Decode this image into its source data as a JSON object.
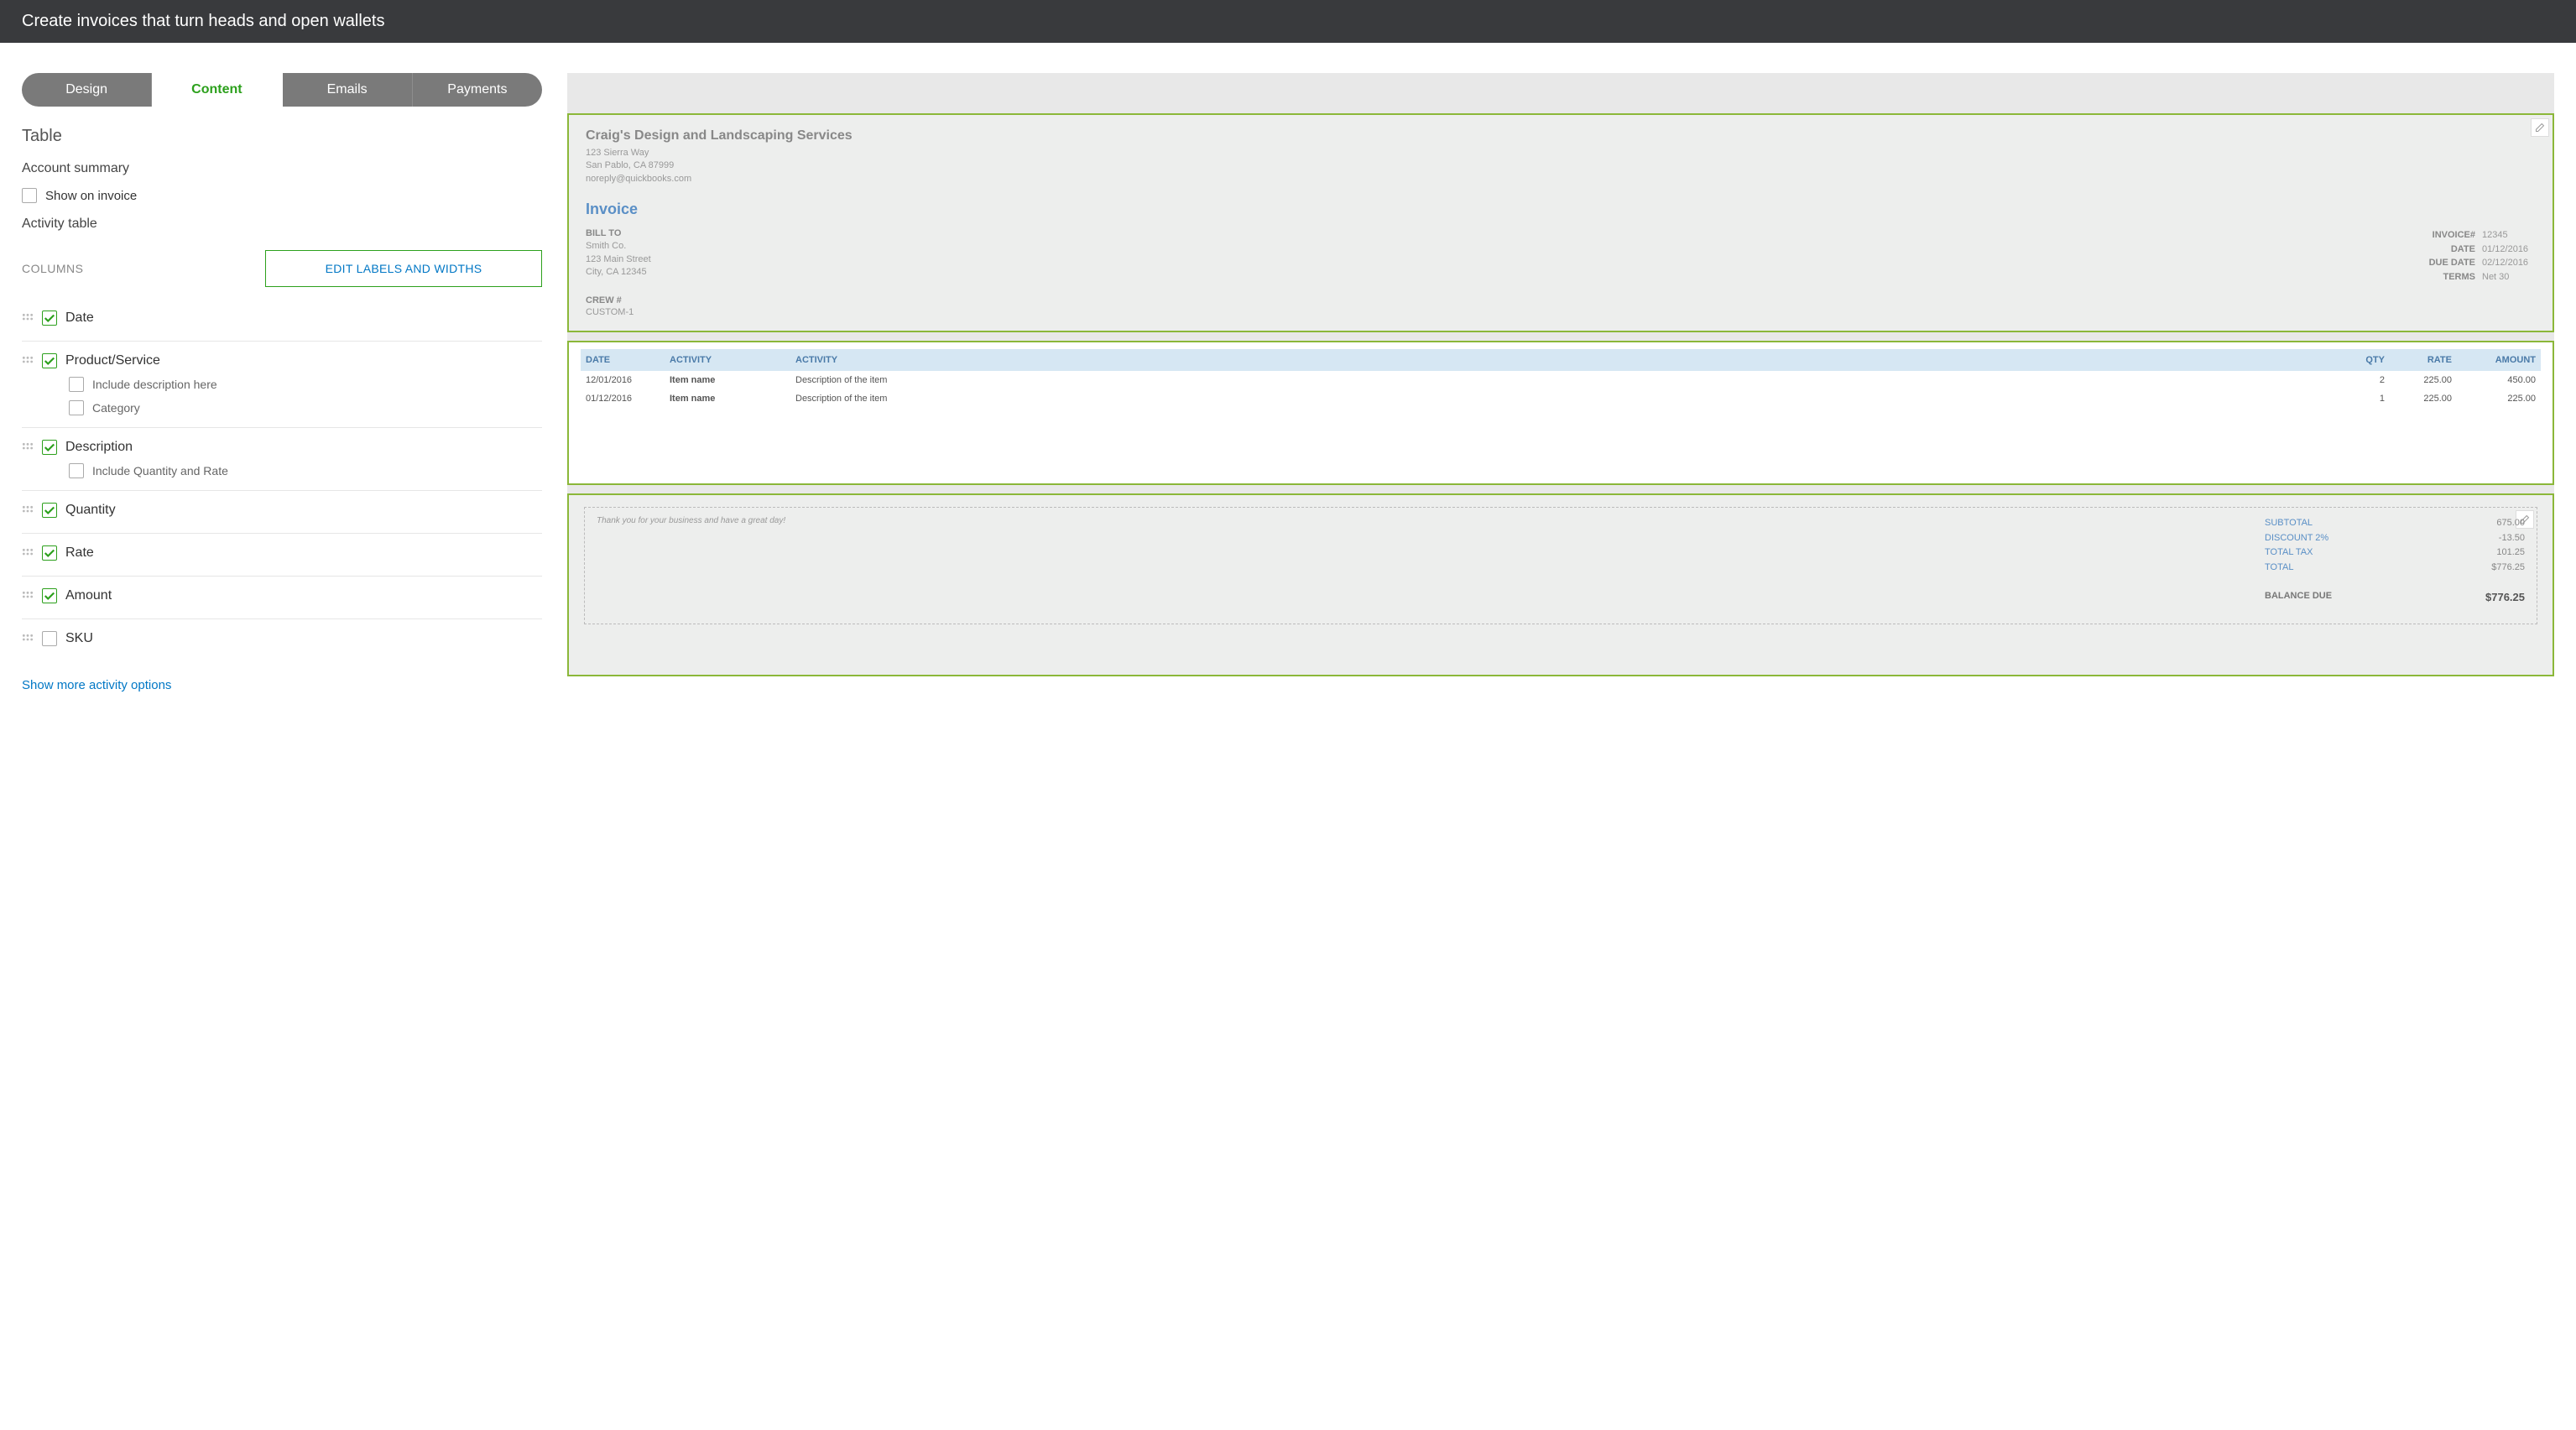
{
  "header": {
    "title": "Create invoices that turn heads and open wallets"
  },
  "tabs": {
    "design": "Design",
    "content": "Content",
    "emails": "Emails",
    "payments": "Payments"
  },
  "left": {
    "table_title": "Table",
    "account_summary": "Account summary",
    "show_on_invoice": "Show on invoice",
    "activity_table": "Activity table",
    "columns_label": "COLUMNS",
    "edit_labels_btn": "EDIT LABELS AND WIDTHS",
    "columns": [
      {
        "name": "Date",
        "checked": true,
        "subs": []
      },
      {
        "name": "Product/Service",
        "checked": true,
        "subs": [
          {
            "label": "Include description here",
            "checked": false
          },
          {
            "label": "Category",
            "checked": false
          }
        ]
      },
      {
        "name": "Description",
        "checked": true,
        "subs": [
          {
            "label": "Include Quantity and Rate",
            "checked": false
          }
        ]
      },
      {
        "name": "Quantity",
        "checked": true,
        "subs": []
      },
      {
        "name": "Rate",
        "checked": true,
        "subs": []
      },
      {
        "name": "Amount",
        "checked": true,
        "subs": []
      },
      {
        "name": "SKU",
        "checked": false,
        "subs": []
      }
    ],
    "show_more": "Show more activity options"
  },
  "preview": {
    "company": {
      "name": "Craig's Design and Landscaping Services",
      "addr1": "123 Sierra Way",
      "addr2": "San Pablo, CA 87999",
      "email": "noreply@quickbooks.com"
    },
    "invoice_title": "Invoice",
    "bill_to_label": "BILL TO",
    "bill_to": {
      "name": "Smith Co.",
      "addr1": "123 Main Street",
      "addr2": "City, CA 12345"
    },
    "meta": {
      "invoice_no_label": "INVOICE#",
      "invoice_no": "12345",
      "date_label": "DATE",
      "date": "01/12/2016",
      "due_label": "DUE DATE",
      "due": "02/12/2016",
      "terms_label": "TERMS",
      "terms": "Net 30"
    },
    "crew_label": "CREW #",
    "crew_val": "CUSTOM-1",
    "line_headers": {
      "date": "DATE",
      "activity1": "ACTIVITY",
      "activity2": "ACTIVITY",
      "qty": "QTY",
      "rate": "RATE",
      "amount": "AMOUNT"
    },
    "lines": [
      {
        "date": "12/01/2016",
        "name": "Item name",
        "desc": "Description of the item",
        "qty": "2",
        "rate": "225.00",
        "amount": "450.00"
      },
      {
        "date": "01/12/2016",
        "name": "Item name",
        "desc": "Description of the item",
        "qty": "1",
        "rate": "225.00",
        "amount": "225.00"
      }
    ],
    "thank_you": "Thank you for your business and have a great day!",
    "totals": {
      "subtotal_label": "SUBTOTAL",
      "subtotal": "675.00",
      "discount_label": "DISCOUNT 2%",
      "discount": "-13.50",
      "tax_label": "TOTAL TAX",
      "tax": "101.25",
      "total_label": "TOTAL",
      "total": "$776.25",
      "balance_label": "BALANCE DUE",
      "balance": "$776.25"
    }
  }
}
